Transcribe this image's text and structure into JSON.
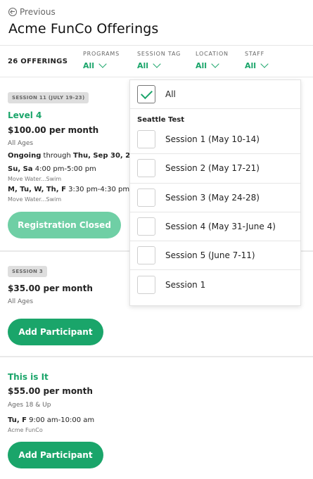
{
  "header": {
    "back_label": "Previous",
    "title": "Acme FunCo Offerings"
  },
  "filterbar": {
    "count_label": "26 OFFERINGS",
    "filters": [
      {
        "label": "PROGRAMS",
        "value": "All"
      },
      {
        "label": "SESSION TAG",
        "value": "All"
      },
      {
        "label": "LOCATION",
        "value": "All"
      },
      {
        "label": "STAFF",
        "value": "All"
      }
    ]
  },
  "offerings": [
    {
      "tag": "SESSION 11 (JULY 19-23)",
      "level": "Level 4",
      "price": "$100.00 per month",
      "ages": "All Ages",
      "ongoing_prefix": "Ongoing",
      "ongoing_mid": " through ",
      "ongoing_date": "Thu, Sep 30, 2",
      "schedule": [
        {
          "days": "Su, Sa",
          "time": " 4:00 pm-5:00 pm",
          "sub": "Move Water...Swim"
        },
        {
          "days": "M, Tu, W, Th, F",
          "time": " 3:30 pm-4:30 pm",
          "sub": "Move Water...Swim"
        }
      ],
      "button": "Registration Closed"
    },
    {
      "tag": "SESSION 3",
      "price": "$35.00 per month",
      "ages": "All Ages",
      "button": "Add Participant"
    },
    {
      "level": "This is It",
      "price": "$55.00 per month",
      "ages": "Ages 18 & Up",
      "schedule": [
        {
          "days": "Tu, F",
          "time": " 9:00 am-10:00 am",
          "sub": "Acme FunCo"
        }
      ],
      "button": "Add Participant"
    }
  ],
  "dropdown": {
    "all_label": "All",
    "group": "Seattle Test",
    "items": [
      "Session 1 (May 10-14)",
      "Session 2 (May 17-21)",
      "Session 3 (May 24-28)",
      "Session 4 (May 31-June 4)",
      "Session 5 (June 7-11)",
      "Session 1"
    ]
  },
  "colors": {
    "accent": "#1aa56a",
    "accent_disabled": "#6fcfa5",
    "tag_bg": "#dedede"
  }
}
